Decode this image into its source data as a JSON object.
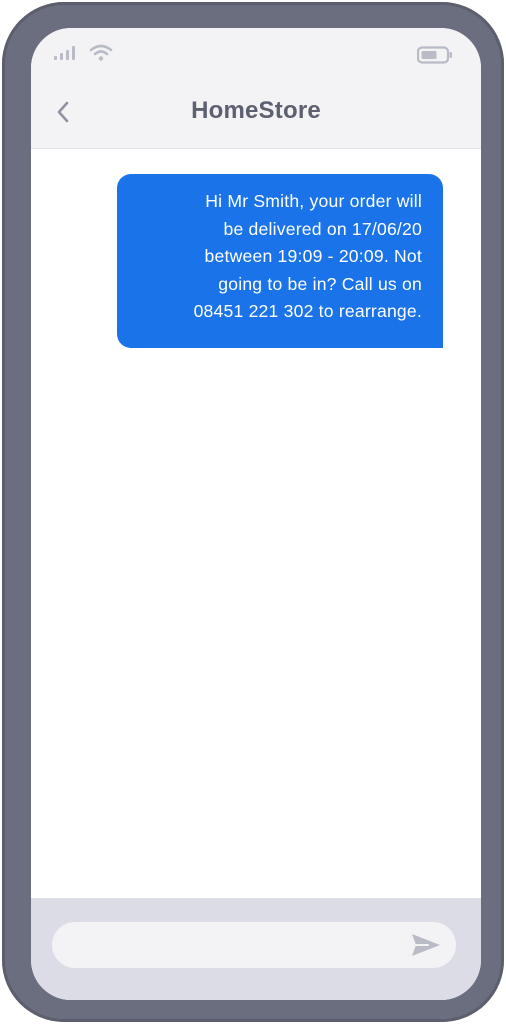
{
  "header": {
    "title": "HomeStore",
    "back_icon": "chevron-left-icon"
  },
  "status_bar": {
    "signal_icon": "cell-signal-icon",
    "wifi_icon": "wifi-icon",
    "battery_icon": "battery-icon"
  },
  "messages": [
    {
      "direction": "incoming",
      "lines": [
        "Hi Mr Smith, your order will",
        "be delivered on 17/06/20",
        "between 19:09 - 20:09. Not",
        "going to be in? Call us on",
        "08451 221 302 to rearrange."
      ]
    }
  ],
  "composer": {
    "placeholder": "",
    "send_icon": "send-icon"
  },
  "colors": {
    "frame": "#6b6e7e",
    "header_bg": "#f3f3f6",
    "title": "#5d6070",
    "bubble": "#1a73e8",
    "composer_bg": "#dcdce6",
    "input_bg": "#f3f3f6",
    "icon": "#b9bbc6"
  }
}
